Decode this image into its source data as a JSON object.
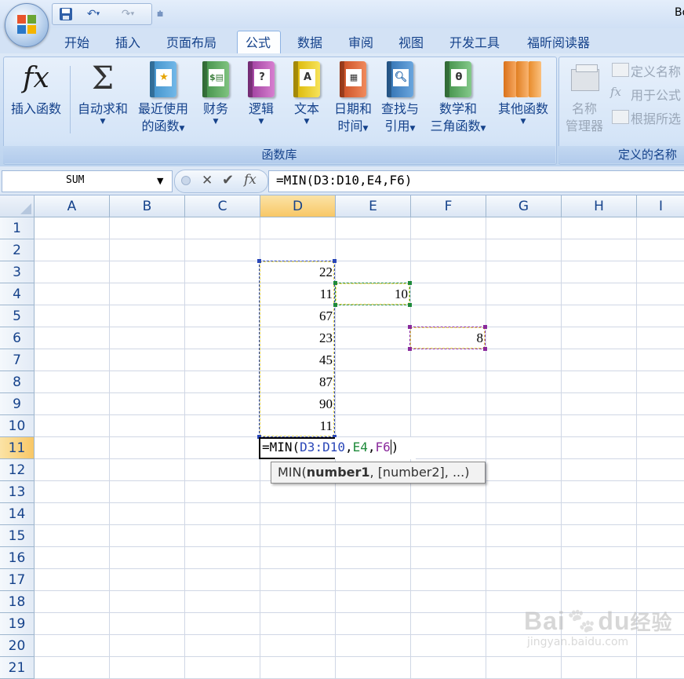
{
  "title": "Bo",
  "tabs": [
    "开始",
    "插入",
    "页面布局",
    "公式",
    "数据",
    "审阅",
    "视图",
    "开发工具",
    "福昕阅读器"
  ],
  "active_tab": "公式",
  "ribbon": {
    "insert_function": "插入函数",
    "autosum": "自动求和",
    "recent_1": "最近使用",
    "recent_2": "的函数",
    "financial": "财务",
    "logical": "逻辑",
    "text": "文本",
    "datetime_1": "日期和",
    "datetime_2": "时间",
    "lookup_1": "查找与",
    "lookup_2": "引用",
    "math_1": "数学和",
    "math_2": "三角函数",
    "more": "其他函数",
    "funclib_label": "函数库",
    "name_manager_1": "名称",
    "name_manager_2": "管理器",
    "define_name": "定义名称",
    "use_in_formula": "用于公式",
    "create_from_sel": "根据所选",
    "names_label": "定义的名称"
  },
  "namebox": "SUM",
  "formula": "=MIN(D3:D10,E4,F6)",
  "columns": [
    "A",
    "B",
    "C",
    "D",
    "E",
    "F",
    "G",
    "H",
    "I"
  ],
  "rows": [
    "1",
    "2",
    "3",
    "4",
    "5",
    "6",
    "7",
    "8",
    "9",
    "10",
    "11",
    "12",
    "13",
    "14",
    "15",
    "16",
    "17",
    "18",
    "19",
    "20",
    "21"
  ],
  "cells": {
    "D3": "22",
    "D4": "11",
    "D5": "67",
    "D6": "23",
    "D7": "45",
    "D8": "87",
    "D9": "90",
    "D10": "11",
    "E4": "10",
    "F6": "8"
  },
  "edit": {
    "prefix": "=MIN(",
    "ref1": "D3:D10",
    "sep1": ",",
    "ref2": "E4",
    "sep2": ",",
    "ref3": "F6",
    "suffix": ")"
  },
  "tooltip": {
    "fn": "MIN(",
    "arg1": "number1",
    "rest": ", [number2], ...)"
  },
  "watermark": {
    "brand": "Bai",
    "brand2": "du",
    "jingyan": "经验",
    "url": "jingyan.baidu.com"
  },
  "colors": {
    "ref1": "#2946b8",
    "ref2": "#1e8a3a",
    "ref3": "#8a2a9c",
    "accent": "#15428b"
  }
}
